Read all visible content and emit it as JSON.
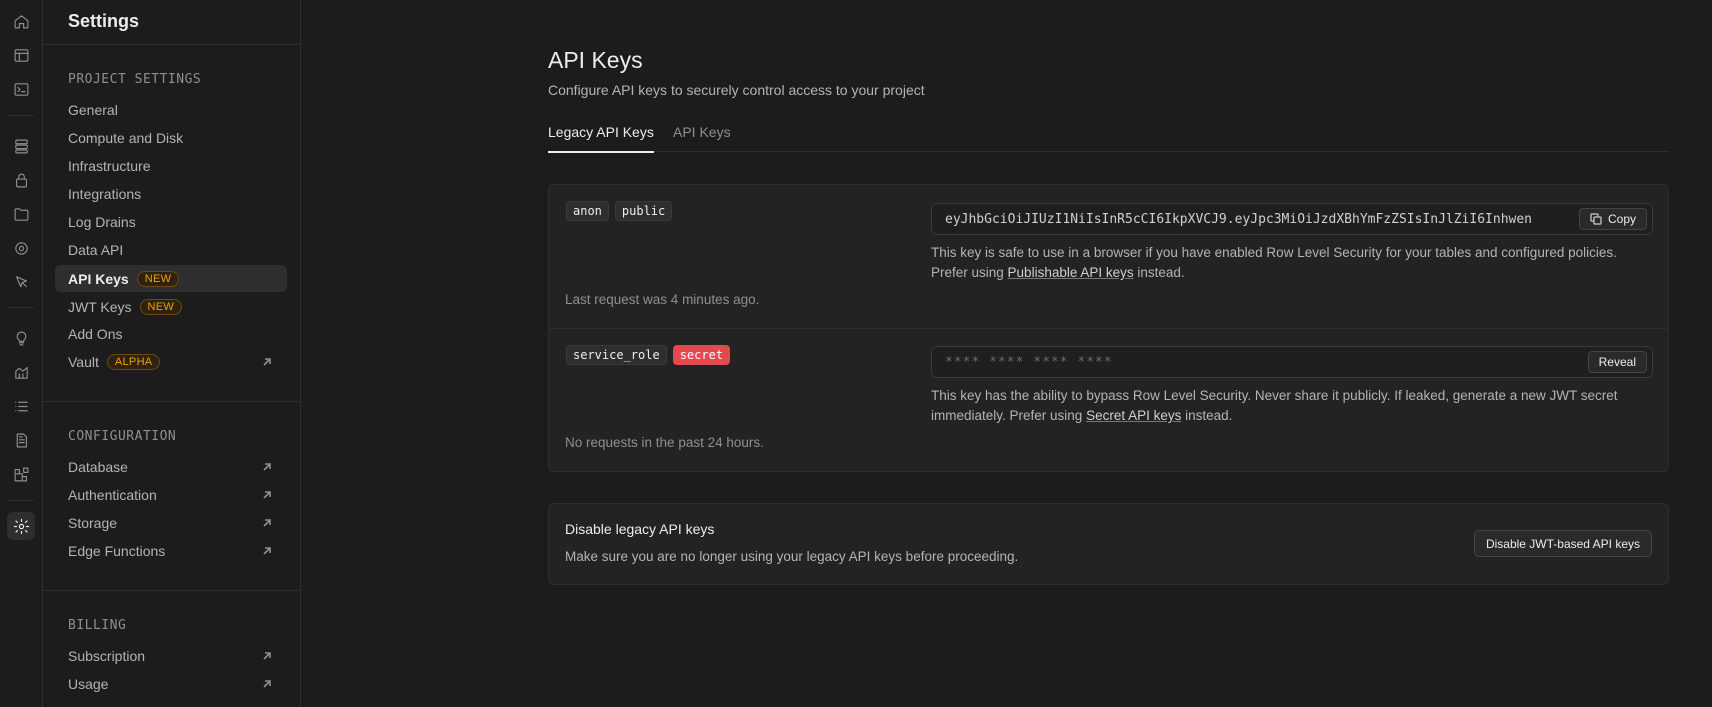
{
  "sidebar": {
    "title": "Settings",
    "groups": [
      {
        "label": "PROJECT SETTINGS",
        "items": [
          {
            "label": "General"
          },
          {
            "label": "Compute and Disk"
          },
          {
            "label": "Infrastructure"
          },
          {
            "label": "Integrations"
          },
          {
            "label": "Log Drains"
          },
          {
            "label": "Data API"
          },
          {
            "label": "API Keys",
            "badge": "NEW",
            "active": true
          },
          {
            "label": "JWT Keys",
            "badge": "NEW"
          },
          {
            "label": "Add Ons"
          },
          {
            "label": "Vault",
            "badge": "ALPHA",
            "external": true
          }
        ]
      },
      {
        "label": "CONFIGURATION",
        "items": [
          {
            "label": "Database",
            "external": true
          },
          {
            "label": "Authentication",
            "external": true
          },
          {
            "label": "Storage",
            "external": true
          },
          {
            "label": "Edge Functions",
            "external": true
          }
        ]
      },
      {
        "label": "BILLING",
        "items": [
          {
            "label": "Subscription",
            "external": true
          },
          {
            "label": "Usage",
            "external": true
          }
        ]
      }
    ]
  },
  "rail": {
    "icons": [
      "home-icon",
      "table-editor-icon",
      "sql-editor-icon",
      "database-icon",
      "authentication-icon",
      "storage-icon",
      "realtime-icon",
      "edge-functions-icon",
      "advisors-icon",
      "reports-icon",
      "logs-icon",
      "api-docs-icon",
      "integrations-icon",
      "settings-icon"
    ]
  },
  "main": {
    "title": "API Keys",
    "description": "Configure API keys to securely control access to your project",
    "tabs": [
      {
        "label": "Legacy API Keys",
        "active": true
      },
      {
        "label": "API Keys"
      }
    ],
    "keys": [
      {
        "tags": [
          "anon",
          "public"
        ],
        "value": "eyJhbGciOiJIUzI1NiIsInR5cCI6IkpXVCJ9.eyJpc3MiOiJzdXBhYmFzZSIsInJlZiI6Inhwen",
        "button": "Copy",
        "help_prefix": "This key is safe to use in a browser if you have enabled Row Level Security for your tables and configured policies. Prefer using ",
        "help_link": "Publishable API keys",
        "help_suffix": " instead.",
        "meta": "Last request was 4 minutes ago."
      },
      {
        "tags": [
          "service_role",
          "secret"
        ],
        "value": "**** **** **** ****",
        "button": "Reveal",
        "help_prefix": "This key has the ability to bypass Row Level Security. Never share it publicly. If leaked, generate a new JWT secret immediately. Prefer using ",
        "help_link": "Secret API keys",
        "help_suffix": " instead.",
        "meta": "No requests in the past 24 hours."
      }
    ],
    "disable": {
      "title": "Disable legacy API keys",
      "description": "Make sure you are no longer using your legacy API keys before proceeding.",
      "button": "Disable JWT-based API keys"
    }
  },
  "colors": {
    "background": "#1c1c1c",
    "card": "#232323",
    "badge": "#f59e0b",
    "danger": "#e5484d"
  }
}
